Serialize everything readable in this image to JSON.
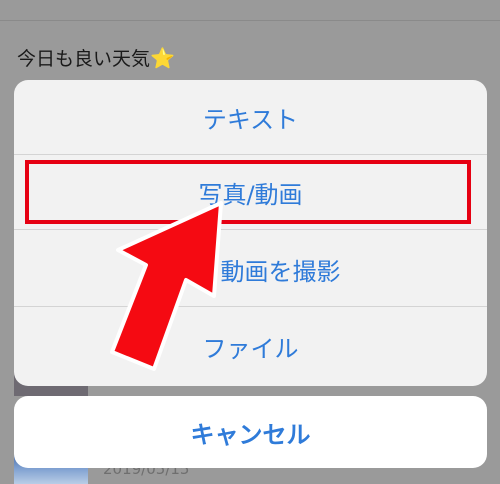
{
  "background": {
    "post_text": "今日も良い天気",
    "post_icon": "star-icon",
    "date_text": "2019/05/15"
  },
  "action_sheet": {
    "options": [
      {
        "label": "テキスト"
      },
      {
        "label": "写真/動画"
      },
      {
        "label": "動画を撮影"
      },
      {
        "label": "ファイル"
      }
    ],
    "highlighted_index": 1,
    "cancel_label": "キャンセル"
  },
  "colors": {
    "accent": "#2f7bd9",
    "highlight": "#e60012",
    "overlay": "#9a9a9a"
  }
}
